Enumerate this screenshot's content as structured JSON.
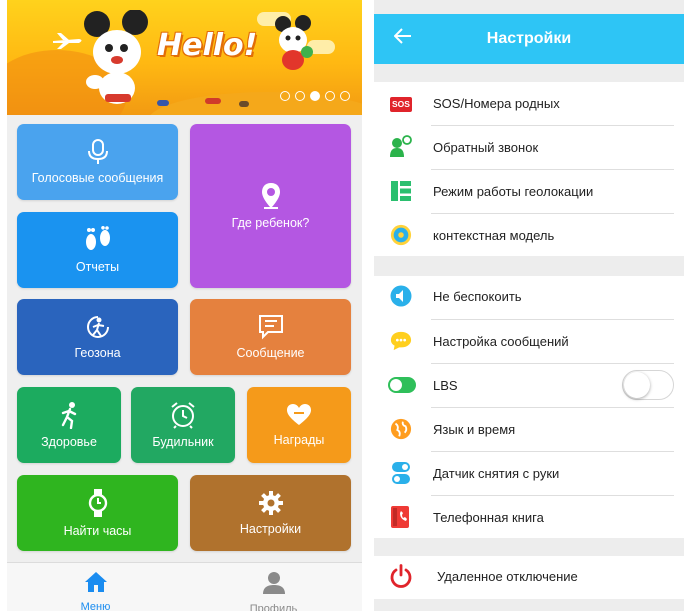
{
  "left_screen": {
    "banner": {
      "text": "Hello!",
      "carousel_pages": 5,
      "carousel_active_page": 3
    },
    "tiles": [
      {
        "label": "Голосовые сообщения",
        "icon": "microphone-icon",
        "color": "#4aa3ee"
      },
      {
        "label": "Где ребенок?",
        "icon": "location-pin-icon",
        "color": "#b457e2"
      },
      {
        "label": "Отчеты",
        "icon": "footprints-icon",
        "color": "#1a93f0"
      },
      {
        "label": "Геозона",
        "icon": "geofence-icon",
        "color": "#2a64bd"
      },
      {
        "label": "Сообщение",
        "icon": "message-icon",
        "color": "#e5813e"
      },
      {
        "label": "Здоровье",
        "icon": "running-icon",
        "color": "#1cab5f"
      },
      {
        "label": "Будильник",
        "icon": "alarm-clock-icon",
        "color": "#22a862"
      },
      {
        "label": "Награды",
        "icon": "heart-icon",
        "color": "#f59a1a"
      },
      {
        "label": "Найти часы",
        "icon": "watch-icon",
        "color": "#2fb51f"
      },
      {
        "label": "Настройки",
        "icon": "gear-icon",
        "color": "#b0722d"
      }
    ],
    "tabbar": {
      "tabs": [
        {
          "label": "Меню",
          "icon": "home-icon",
          "active": true,
          "color": "#1a8cf0"
        },
        {
          "label": "Профиль",
          "icon": "person-icon",
          "active": false,
          "color": "#8a8a8a"
        }
      ]
    }
  },
  "right_screen": {
    "header": {
      "title": "Настройки",
      "back_icon": "arrow-left-icon",
      "color": "#2ec5f5"
    },
    "groups": [
      {
        "items": [
          {
            "label": "SOS/Номера родных",
            "icon": "sos-icon",
            "icon_text": "SOS"
          },
          {
            "label": "Обратный звонок",
            "icon": "callback-icon"
          },
          {
            "label": "Режим работы геолокации",
            "icon": "location-mode-icon"
          },
          {
            "label": "контекстная модель",
            "icon": "context-model-icon"
          }
        ]
      },
      {
        "items": [
          {
            "label": "Не беспокоить",
            "icon": "do-not-disturb-icon"
          },
          {
            "label": "Настройка сообщений",
            "icon": "message-settings-icon"
          },
          {
            "label": "LBS",
            "icon": "lbs-icon",
            "toggle": false
          },
          {
            "label": "Язык и время",
            "icon": "language-time-icon"
          },
          {
            "label": "Датчик снятия с руки",
            "icon": "wrist-sensor-icon"
          },
          {
            "label": "Телефонная книга",
            "icon": "phonebook-icon"
          }
        ]
      },
      {
        "items": [
          {
            "label": "Удаленное отключение",
            "icon": "power-icon"
          }
        ]
      }
    ]
  }
}
